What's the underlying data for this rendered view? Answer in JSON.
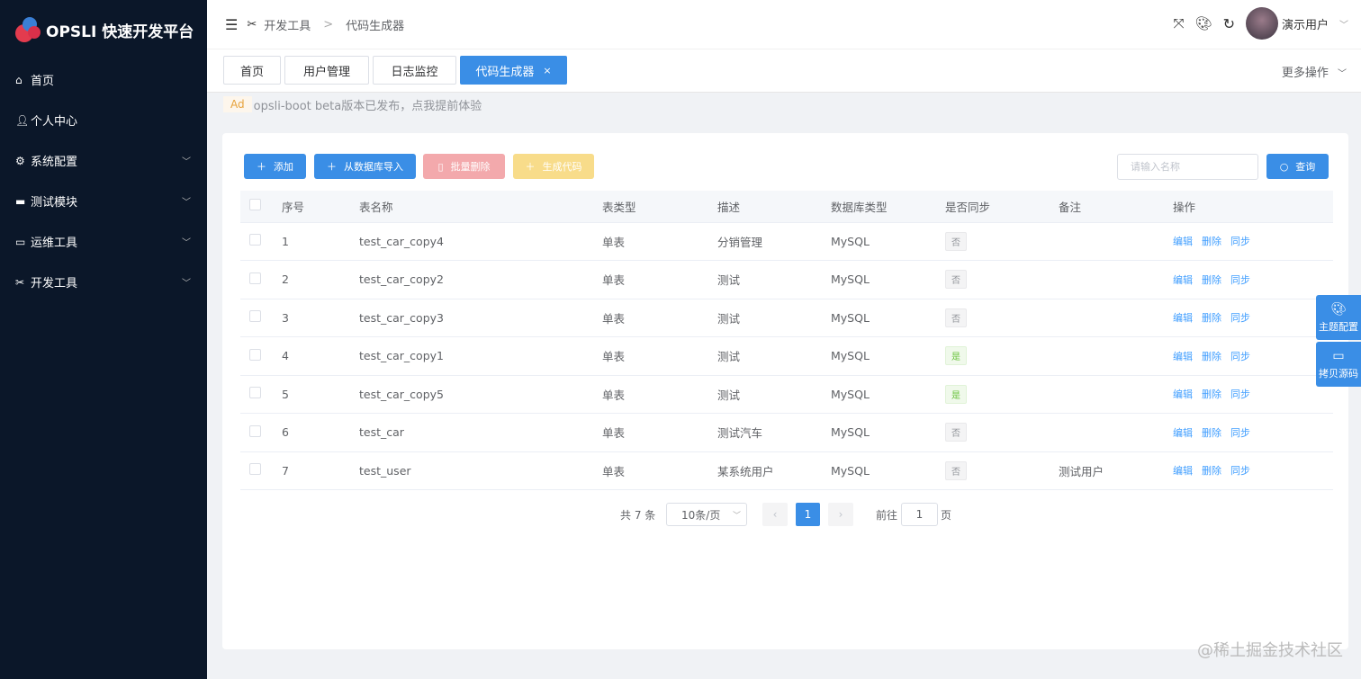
{
  "app": {
    "title": "OPSLI 快速开发平台"
  },
  "sidebar": {
    "items": [
      {
        "label": "首页",
        "icon": "home-icon",
        "has_children": false
      },
      {
        "label": "个人中心",
        "icon": "user-icon",
        "has_children": false
      },
      {
        "label": "系统配置",
        "icon": "gear-icon",
        "has_children": true
      },
      {
        "label": "测试模块",
        "icon": "box-icon",
        "has_children": true
      },
      {
        "label": "运维工具",
        "icon": "monitor-icon",
        "has_children": true
      },
      {
        "label": "开发工具",
        "icon": "tools-icon",
        "has_children": true
      }
    ]
  },
  "header": {
    "breadcrumb": [
      "开发工具",
      "代码生成器"
    ],
    "user": "演示用户"
  },
  "tabs": [
    {
      "label": "首页"
    },
    {
      "label": "用户管理"
    },
    {
      "label": "日志监控"
    },
    {
      "label": "代码生成器",
      "active": true
    }
  ],
  "more_actions": "更多操作",
  "ad": {
    "badge": "Ad",
    "text": "opsli-boot beta版本已发布，点我提前体验"
  },
  "toolbar": {
    "add": "添加",
    "import": "从数据库导入",
    "batch_delete": "批量删除",
    "generate": "生成代码",
    "search_placeholder": "请输入名称",
    "search_btn": "查询"
  },
  "table": {
    "headers": [
      "序号",
      "表名称",
      "表类型",
      "描述",
      "数据库类型",
      "是否同步",
      "备注",
      "操作"
    ],
    "rows": [
      {
        "no": "1",
        "name": "test_car_copy4",
        "type": "单表",
        "desc": "分销管理",
        "db": "MySQL",
        "sync": "否",
        "remark": ""
      },
      {
        "no": "2",
        "name": "test_car_copy2",
        "type": "单表",
        "desc": "测试",
        "db": "MySQL",
        "sync": "否",
        "remark": ""
      },
      {
        "no": "3",
        "name": "test_car_copy3",
        "type": "单表",
        "desc": "测试",
        "db": "MySQL",
        "sync": "否",
        "remark": ""
      },
      {
        "no": "4",
        "name": "test_car_copy1",
        "type": "单表",
        "desc": "测试",
        "db": "MySQL",
        "sync": "是",
        "remark": ""
      },
      {
        "no": "5",
        "name": "test_car_copy5",
        "type": "单表",
        "desc": "测试",
        "db": "MySQL",
        "sync": "是",
        "remark": ""
      },
      {
        "no": "6",
        "name": "test_car",
        "type": "单表",
        "desc": "测试汽车",
        "db": "MySQL",
        "sync": "否",
        "remark": ""
      },
      {
        "no": "7",
        "name": "test_user",
        "type": "单表",
        "desc": "某系统用户",
        "db": "MySQL",
        "sync": "否",
        "remark": "测试用户"
      }
    ],
    "ops": [
      "编辑",
      "删除",
      "同步"
    ]
  },
  "pagination": {
    "total": "共 7 条",
    "page_size": "10条/页",
    "current": "1",
    "goto_label": "前往",
    "goto_value": "1",
    "page_suffix": "页"
  },
  "float": {
    "theme": "主题配置",
    "copy": "拷贝源码"
  },
  "watermark": "@稀土掘金技术社区"
}
